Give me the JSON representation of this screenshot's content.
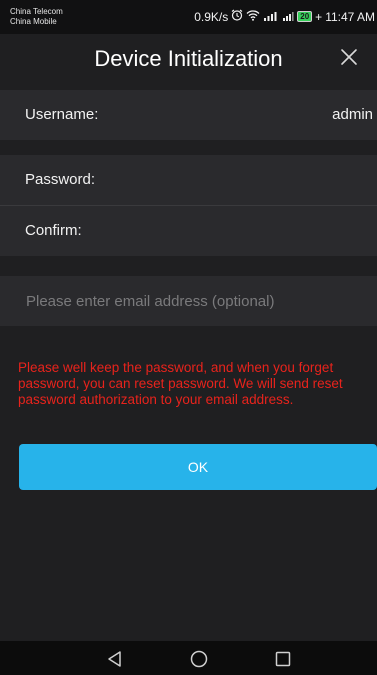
{
  "status_bar": {
    "carrier_1": "China Telecom",
    "carrier_2": "China Mobile",
    "network_speed": "0.9K/s",
    "battery": "20",
    "time": "11:47 AM"
  },
  "header": {
    "title": "Device Initialization",
    "close_icon": "close-icon"
  },
  "form": {
    "username_label": "Username:",
    "username_value": "admin",
    "password_label": "Password:",
    "password_value": "",
    "confirm_label": "Confirm:",
    "confirm_value": "",
    "email_placeholder": "Please enter email address (optional)",
    "email_value": ""
  },
  "warning_text": "Please well keep the password, and when you forget password, you can reset password. We will send reset password authorization to your email address.",
  "ok_button": {
    "label": "OK"
  },
  "nav_bar": {
    "back_icon": "back-triangle-icon",
    "home_icon": "home-circle-icon",
    "recents_icon": "recents-square-icon"
  },
  "colors": {
    "background": "#1f1f21",
    "row_background": "#2a2a2d",
    "accent": "#27b3ea",
    "warning": "#e8231c"
  }
}
